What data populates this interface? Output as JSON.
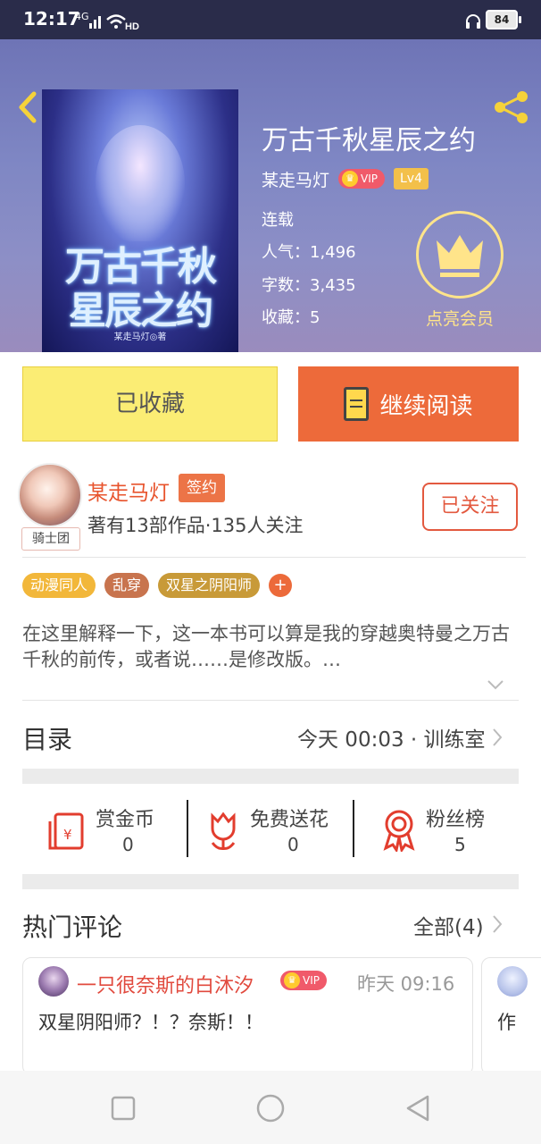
{
  "status_bar": {
    "time": "12:17",
    "network": "4G",
    "battery": "84"
  },
  "book": {
    "title": "万古千秋星辰之约",
    "author": "某走马灯",
    "vip_label": "VIP",
    "level": "Lv4",
    "status": "连载",
    "popularity_label": "人气：",
    "popularity": "1,496",
    "words_label": "字数：",
    "words": "3,435",
    "favorites_label": "收藏：",
    "favorites": "5",
    "cover_title_line1": "万古千秋",
    "cover_title_line2": "星辰之约",
    "cover_author": "某走马灯◎著"
  },
  "member": {
    "label": "点亮会员"
  },
  "actions": {
    "favorite_label": "已收藏",
    "read_label": "继续阅读"
  },
  "author_info": {
    "name": "某走马灯",
    "sign_tag": "签约",
    "guild_tag": "骑士团",
    "stats": "著有13部作品·135人关注",
    "follow_label": "已关注"
  },
  "tags": [
    {
      "label": "动漫同人",
      "color": "#f2b73a"
    },
    {
      "label": "乱穿",
      "color": "#c8744e"
    },
    {
      "label": "双星之阴阳师",
      "color": "#c89a38"
    }
  ],
  "tag_more": "+",
  "intro": "在这里解释一下，这一本书可以算是我的穿越奥特曼之万古千秋的前传，或者说……是修改版。…",
  "toc": {
    "label": "目录",
    "latest": "今天 00:03 · 训练室"
  },
  "rewards": [
    {
      "label": "赏金币",
      "value": "0",
      "icon": "red-envelope-icon"
    },
    {
      "label": "免费送花",
      "value": "0",
      "icon": "flower-icon"
    },
    {
      "label": "粉丝榜",
      "value": "5",
      "icon": "medal-icon"
    }
  ],
  "comments": {
    "label": "热门评论",
    "all_label": "全部(4)",
    "items": [
      {
        "user": "一只很奈斯的白沐汐",
        "vip": "VIP",
        "time": "昨天 09:16",
        "text": "双星阴阳师？！？奈斯！！"
      },
      {
        "text": "作"
      }
    ]
  },
  "colors": {
    "accent_orange": "#ed6a3a",
    "favorite_yellow": "#fbed74",
    "member_gold": "#ffe48a",
    "header_purple": "#7f87c4"
  }
}
